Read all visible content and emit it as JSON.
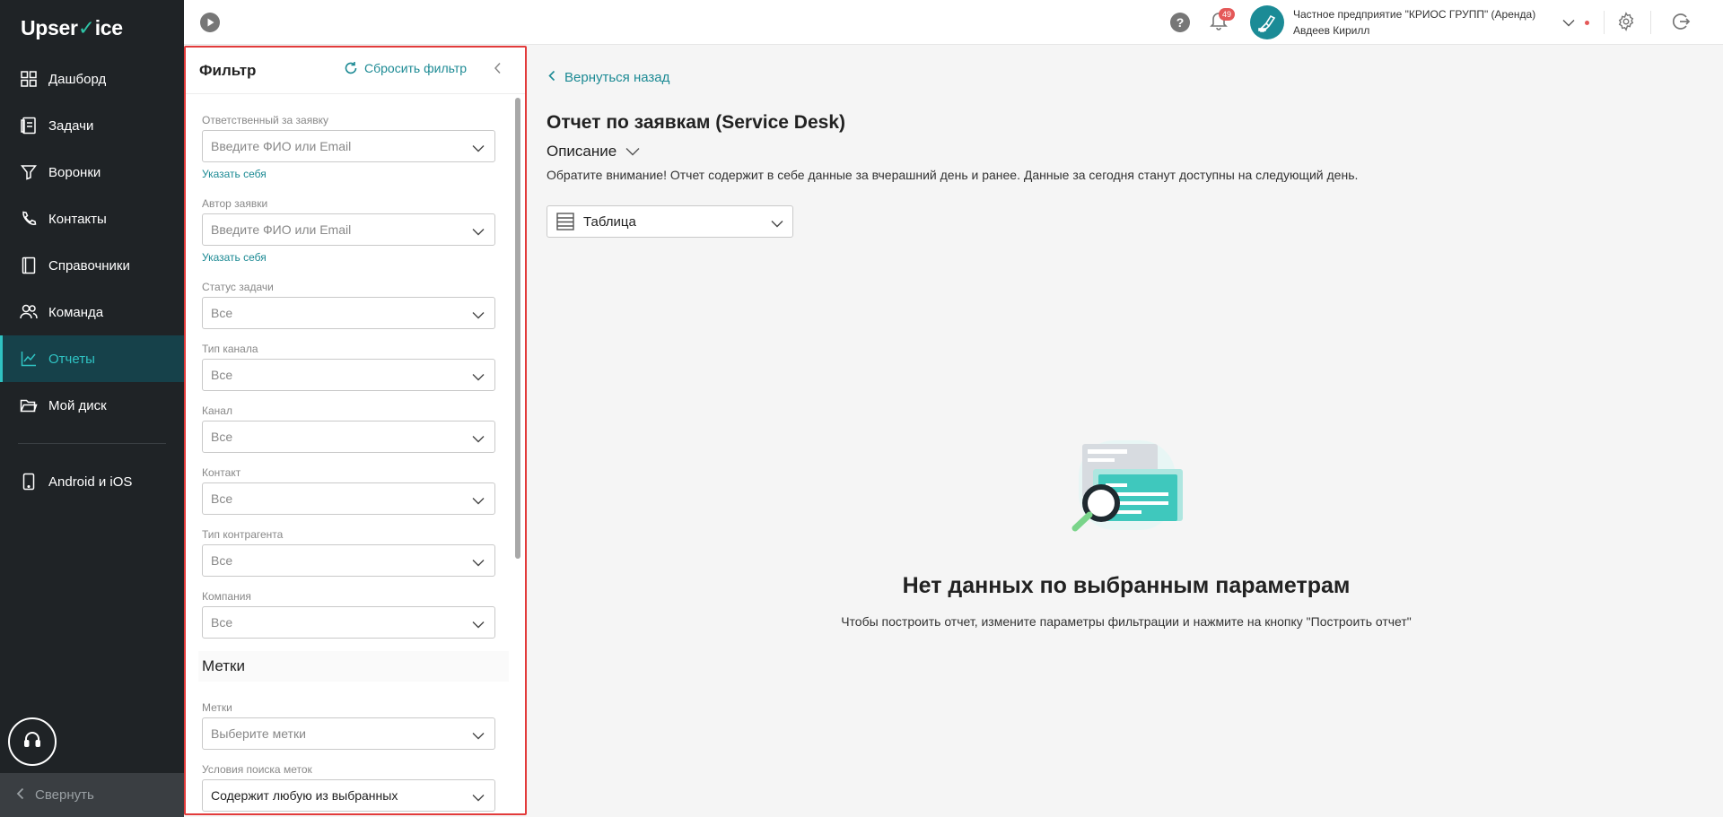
{
  "app": {
    "logo_prefix": "Upser",
    "logo_check": "✓",
    "logo_suffix": "ice"
  },
  "sidebar": {
    "items": [
      {
        "label": "Дашборд",
        "icon": "dashboard-icon"
      },
      {
        "label": "Задачи",
        "icon": "tasks-icon"
      },
      {
        "label": "Воронки",
        "icon": "funnel-icon"
      },
      {
        "label": "Контакты",
        "icon": "contacts-icon"
      },
      {
        "label": "Справочники",
        "icon": "book-icon"
      },
      {
        "label": "Команда",
        "icon": "team-icon"
      },
      {
        "label": "Отчеты",
        "icon": "reports-icon",
        "active": true
      },
      {
        "label": "Мой диск",
        "icon": "folder-icon"
      }
    ],
    "mobile_label": "Android и iOS",
    "collapse_label": "Свернуть"
  },
  "topbar": {
    "notifications_count": "49",
    "org_name": "Частное предприятие \"КРИОС ГРУПП\" (Аренда)",
    "user_name": "Авдеев Кирилл"
  },
  "filter": {
    "title": "Фильтр",
    "reset_label": "Сбросить фильтр",
    "assignee": {
      "label": "Ответственный за заявку",
      "placeholder": "Введите ФИО или Email",
      "me_link": "Указать себя"
    },
    "author": {
      "label": "Автор заявки",
      "placeholder": "Введите ФИО или Email",
      "me_link": "Указать себя"
    },
    "task_status": {
      "label": "Статус задачи",
      "value": "Все"
    },
    "channel_type": {
      "label": "Тип канала",
      "value": "Все"
    },
    "channel": {
      "label": "Канал",
      "value": "Все"
    },
    "contact": {
      "label": "Контакт",
      "value": "Все"
    },
    "counterparty_type": {
      "label": "Тип контрагента",
      "value": "Все"
    },
    "company": {
      "label": "Компания",
      "value": "Все"
    },
    "tags_section_title": "Метки",
    "tags": {
      "label": "Метки",
      "placeholder": "Выберите метки"
    },
    "tag_search": {
      "label": "Условия поиска меток",
      "value": "Содержит любую из выбранных"
    }
  },
  "main": {
    "back_label": "Вернуться назад",
    "title": "Отчет по заявкам (Service Desk)",
    "description_toggle": "Описание",
    "notice": "Обратите внимание! Отчет содержит в себе данные за вчерашний день и ранее. Данные за сегодня станут доступны на следующий день.",
    "view_select": "Таблица",
    "empty_title": "Нет данных по выбранным параметрам",
    "empty_subtitle": "Чтобы построить отчет, измените параметры фильтрации и нажмите на кнопку \"Построить отчет\""
  },
  "colors": {
    "accent": "#1c8a94",
    "sidebar_bg": "#1f2326",
    "active_bg": "#16414a",
    "highlight_border": "#e23b3b"
  }
}
